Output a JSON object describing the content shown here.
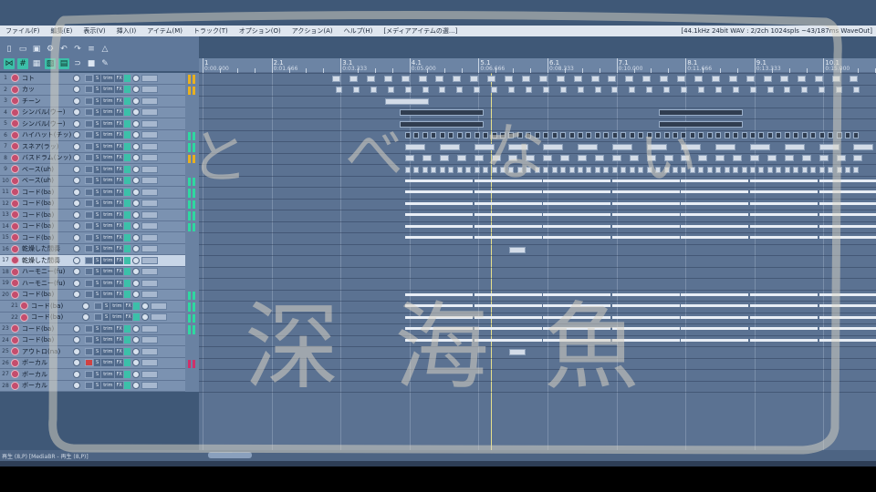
{
  "menubar": {
    "items": [
      "ファイル(F)",
      "編集(E)",
      "表示(V)",
      "挿入(I)",
      "アイテム(M)",
      "トラック(T)",
      "オプション(O)",
      "アクション(A)",
      "ヘルプ(H)"
    ],
    "media_label": "[メディアアイテムの選...]",
    "status": "[44.1kHz 24bit WAV : 2/2ch 1024spls ~43/187ms WaveOut]"
  },
  "toolbar": {
    "row1_icons": [
      "new-file-icon",
      "open-icon",
      "save-icon",
      "settings-icon",
      "undo-icon",
      "redo-icon",
      "ripple-icon",
      "metronome-icon"
    ],
    "row2_icons": [
      "snap-icon",
      "grid-icon",
      "lock-icon",
      "crossfade-icon",
      "loop-icon",
      "trim-icon",
      "locked-icon",
      "pencil-icon"
    ]
  },
  "ruler": {
    "marks": [
      {
        "bar": "1",
        "time": "0:00.000"
      },
      {
        "bar": "2.1",
        "time": "0:01.666"
      },
      {
        "bar": "3.1",
        "time": "0:03.333"
      },
      {
        "bar": "4.1",
        "time": "0:05.000"
      },
      {
        "bar": "5.1",
        "time": "0:06.666"
      },
      {
        "bar": "6.1",
        "time": "0:08.333"
      },
      {
        "bar": "7.1",
        "time": "0:10.000"
      },
      {
        "bar": "8.1",
        "time": "0:11.666"
      },
      {
        "bar": "9.1",
        "time": "0:13.333"
      },
      {
        "bar": "10.1",
        "time": "0:15.000"
      }
    ]
  },
  "tracks": [
    {
      "num": "1",
      "name": "コト"
    },
    {
      "num": "2",
      "name": "カッ"
    },
    {
      "num": "3",
      "name": "チーン"
    },
    {
      "num": "4",
      "name": "シンバル(ウー)"
    },
    {
      "num": "5",
      "name": "シンバル(ウー)"
    },
    {
      "num": "6",
      "name": "ハイハット(チッ)"
    },
    {
      "num": "7",
      "name": "スネア(ラッ)"
    },
    {
      "num": "8",
      "name": "バスドラム(ンッ)"
    },
    {
      "num": "9",
      "name": "ベース(uh)"
    },
    {
      "num": "10",
      "name": "ベース(uh)"
    },
    {
      "num": "11",
      "name": "コード(ba)"
    },
    {
      "num": "12",
      "name": "コード(ba)"
    },
    {
      "num": "13",
      "name": "コード(ba)"
    },
    {
      "num": "14",
      "name": "コード(ba)"
    },
    {
      "num": "15",
      "name": "コード(ba)"
    },
    {
      "num": "16",
      "name": "乾燥した間奏"
    },
    {
      "num": "17",
      "name": "乾燥した間奏"
    },
    {
      "num": "18",
      "name": "ハーモニー(fu)"
    },
    {
      "num": "19",
      "name": "ハーモニー(fu)"
    },
    {
      "num": "20",
      "name": "コード(ba)"
    },
    {
      "num": "21",
      "name": "コード(ba)"
    },
    {
      "num": "22",
      "name": "コード(ba)"
    },
    {
      "num": "23",
      "name": "コード(ba)"
    },
    {
      "num": "24",
      "name": "コード(ba)"
    },
    {
      "num": "25",
      "name": "アウトロ(na)"
    },
    {
      "num": "26",
      "name": "ボーカル"
    },
    {
      "num": "27",
      "name": "ボーカル"
    },
    {
      "num": "28",
      "name": "ボーカル"
    }
  ],
  "track_controls": {
    "solo_tag": "S",
    "mute_tag": "M",
    "trim_tag": "trim",
    "fx_tag": "FX"
  },
  "overlay_text": {
    "hiragana": [
      "と",
      "べ",
      "な",
      "い"
    ],
    "kanji": [
      "深",
      "海",
      "魚"
    ]
  },
  "bottom": {
    "status_left": "再生 (8,P) [MediaBR - 再生 (8,P)]"
  },
  "colors": {
    "accent": "#3cc0a9",
    "record": "#c44d6d",
    "meter": "#2fd8a0",
    "playhead": "#e6e08c"
  }
}
